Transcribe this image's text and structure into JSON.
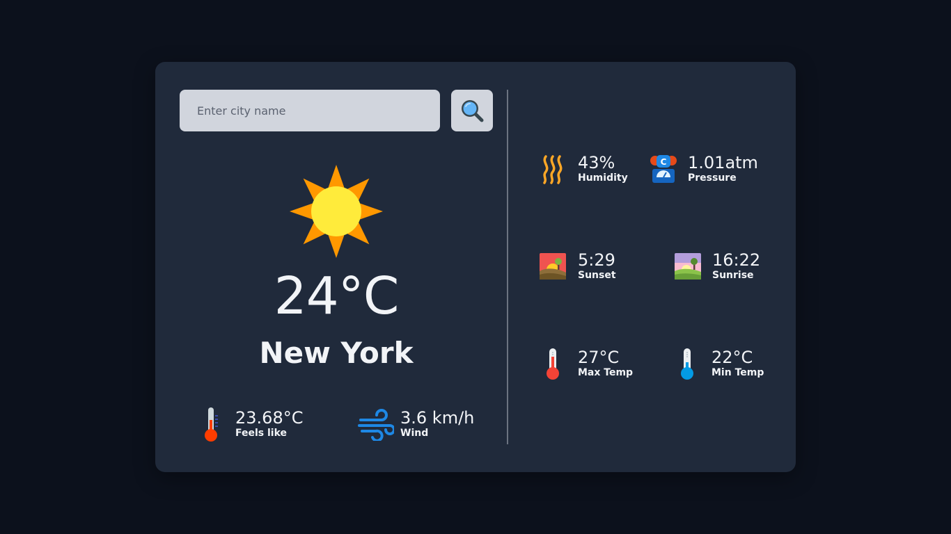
{
  "search": {
    "placeholder": "Enter city name",
    "button_icon": "search-icon"
  },
  "current": {
    "icon": "sun-icon",
    "temperature": "24°C",
    "city": "New York"
  },
  "bottom_stats": [
    {
      "icon": "thermometer-icon",
      "value": "23.68°C",
      "label": "Feels like"
    },
    {
      "icon": "wind-icon",
      "value": "3.6 km/h",
      "label": "Wind"
    }
  ],
  "details": [
    {
      "icon": "humidity-icon",
      "value": "43%",
      "label": "Humidity"
    },
    {
      "icon": "pressure-icon",
      "value": "1.01atm",
      "label": "Pressure"
    },
    {
      "icon": "sunset-icon",
      "value": "5:29",
      "label": "Sunset"
    },
    {
      "icon": "sunrise-icon",
      "value": "16:22",
      "label": "Sunrise"
    },
    {
      "icon": "thermometer-hot-icon",
      "value": "27°C",
      "label": "Max Temp"
    },
    {
      "icon": "thermometer-cold-icon",
      "value": "22°C",
      "label": "Min Temp"
    }
  ],
  "colors": {
    "background": "#0c111c",
    "card": "#202a3b",
    "input": "#d1d5dd",
    "text": "#f2f4f7",
    "sun_outer": "#ff9800",
    "sun_inner": "#ffeb3b"
  }
}
